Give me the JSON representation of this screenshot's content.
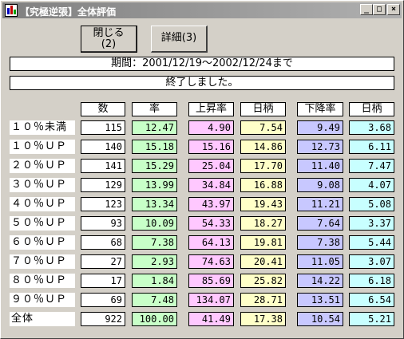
{
  "window": {
    "title": "【究極逆張】全体評価"
  },
  "titlebar_buttons": {
    "minimize": "_",
    "maximize": "□",
    "close": "×"
  },
  "buttons": {
    "close_line1": "閉じる",
    "close_line2": "(2)",
    "detail": "詳細(3)"
  },
  "period": "期間：2001/12/19～2002/12/24まで",
  "status": "終了しました。",
  "headers": {
    "count": "数",
    "rate": "率",
    "up_rate": "上昇率",
    "up_days": "日柄",
    "down_rate": "下降率",
    "down_days": "日柄"
  },
  "colors": {
    "rate": "#c8ffc8",
    "up_rate": "#ffc8ff",
    "up_days": "#ffffc8",
    "down_rate": "#c8c8ff",
    "down_days": "#c8ffff"
  },
  "rows": [
    {
      "label": "１０％未満",
      "count": "115",
      "rate": "12.47",
      "up_rate": "4.90",
      "up_days": "7.54",
      "down_rate": "9.49",
      "down_days": "3.68"
    },
    {
      "label": "１０％ＵＰ",
      "count": "140",
      "rate": "15.18",
      "up_rate": "15.16",
      "up_days": "14.86",
      "down_rate": "12.73",
      "down_days": "6.11"
    },
    {
      "label": "２０％ＵＰ",
      "count": "141",
      "rate": "15.29",
      "up_rate": "25.04",
      "up_days": "17.70",
      "down_rate": "11.40",
      "down_days": "7.47"
    },
    {
      "label": "３０％ＵＰ",
      "count": "129",
      "rate": "13.99",
      "up_rate": "34.84",
      "up_days": "16.88",
      "down_rate": "9.08",
      "down_days": "4.07"
    },
    {
      "label": "４０％ＵＰ",
      "count": "123",
      "rate": "13.34",
      "up_rate": "43.97",
      "up_days": "19.43",
      "down_rate": "11.21",
      "down_days": "5.08"
    },
    {
      "label": "５０％ＵＰ",
      "count": "93",
      "rate": "10.09",
      "up_rate": "54.33",
      "up_days": "18.27",
      "down_rate": "7.64",
      "down_days": "3.37"
    },
    {
      "label": "６０％ＵＰ",
      "count": "68",
      "rate": "7.38",
      "up_rate": "64.13",
      "up_days": "19.81",
      "down_rate": "7.38",
      "down_days": "5.44"
    },
    {
      "label": "７０％ＵＰ",
      "count": "27",
      "rate": "2.93",
      "up_rate": "74.63",
      "up_days": "20.41",
      "down_rate": "11.05",
      "down_days": "3.07"
    },
    {
      "label": "８０％ＵＰ",
      "count": "17",
      "rate": "1.84",
      "up_rate": "85.69",
      "up_days": "25.82",
      "down_rate": "14.22",
      "down_days": "6.18"
    },
    {
      "label": "９０％ＵＰ",
      "count": "69",
      "rate": "7.48",
      "up_rate": "134.07",
      "up_days": "28.71",
      "down_rate": "13.51",
      "down_days": "6.54"
    },
    {
      "label": "全体",
      "count": "922",
      "rate": "100.00",
      "up_rate": "41.49",
      "up_days": "17.38",
      "down_rate": "10.54",
      "down_days": "5.21"
    }
  ]
}
